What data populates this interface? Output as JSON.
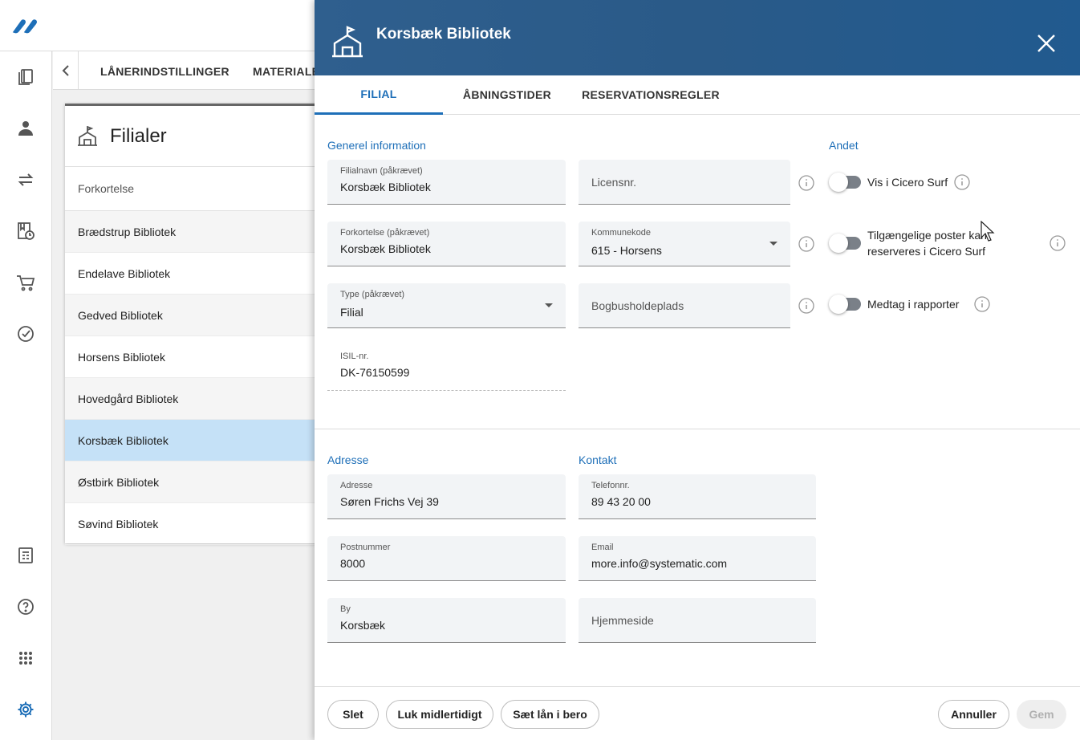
{
  "colors": {
    "brand": "#215a8f",
    "accent": "#1e6fb8",
    "selected_row": "#c5e1f7"
  },
  "app": {
    "logo": "app-logo",
    "rail_icons": [
      "books-icon",
      "patron-icon",
      "transfer-icon",
      "calendar-clock-icon",
      "cart-icon",
      "check-circle-icon",
      "report-icon",
      "help-icon",
      "apps-grid-icon",
      "gear-icon"
    ],
    "tabs": [
      "LÅNERINDSTILLINGER",
      "MATERIALEG"
    ]
  },
  "branches_card": {
    "title": "Filialer",
    "column_header": "Forkortelse",
    "rows": [
      "Brædstrup Bibliotek",
      "Endelave Bibliotek",
      "Gedved Bibliotek",
      "Horsens Bibliotek",
      "Hovedgård Bibliotek",
      "Korsbæk Bibliotek",
      "Østbirk Bibliotek",
      "Søvind Bibliotek"
    ],
    "selected_index": 5
  },
  "drawer": {
    "title": "Korsbæk Bibliotek",
    "tabs": [
      "FILIAL",
      "ÅBNINGSTIDER",
      "RESERVATIONSREGLER"
    ],
    "active_tab": "FILIAL",
    "general": {
      "heading": "Generel information",
      "branch_name": {
        "label": "Filialnavn (påkrævet)",
        "value": "Korsbæk Bibliotek"
      },
      "license": {
        "placeholder": "Licensnr."
      },
      "abbreviation": {
        "label": "Forkortelse (påkrævet)",
        "value": "Korsbæk Bibliotek"
      },
      "municipality": {
        "label": "Kommunekode",
        "value": "615 - Horsens"
      },
      "type": {
        "label": "Type (påkrævet)",
        "value": "Filial"
      },
      "bookkeeping": {
        "placeholder": "Bogbusholdeplads"
      },
      "isil": {
        "label": "ISIL-nr.",
        "value": "DK-76150599"
      }
    },
    "other": {
      "heading": "Andet",
      "toggles": [
        {
          "label": "Vis i Cicero Surf",
          "on": false
        },
        {
          "label": "Tilgængelige poster kan reserveres i Cicero Surf",
          "line1": "Tilgængelige poster kan",
          "line2": "reserveres i Cicero Surf",
          "on": false
        },
        {
          "label": "Medtag i rapporter",
          "on": false
        }
      ]
    },
    "address": {
      "heading": "Adresse",
      "street": {
        "label": "Adresse",
        "value": "Søren Frichs Vej 39"
      },
      "postcode": {
        "label": "Postnummer",
        "value": "8000"
      },
      "city": {
        "label": "By",
        "value": "Korsbæk"
      }
    },
    "contact": {
      "heading": "Kontakt",
      "phone": {
        "label": "Telefonnr.",
        "value": "89 43 20 00"
      },
      "email": {
        "label": "Email",
        "value": "more.info@systematic.com"
      },
      "website": {
        "placeholder": "Hjemmeside"
      }
    },
    "footer": {
      "delete": "Slet",
      "close_temp": "Luk midlertidigt",
      "suspend_loans": "Sæt lån i bero",
      "cancel": "Annuller",
      "save": "Gem"
    }
  }
}
